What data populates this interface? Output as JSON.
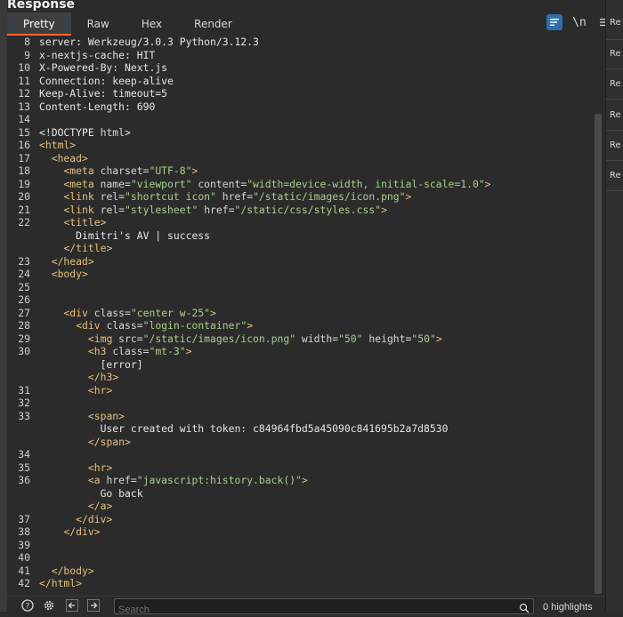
{
  "panel": {
    "title": "Response"
  },
  "tabs": [
    {
      "label": "Pretty",
      "active": true
    },
    {
      "label": "Raw"
    },
    {
      "label": "Hex"
    },
    {
      "label": "Render"
    }
  ],
  "toolbar": {
    "wrap_icon": "wrap-lines-icon",
    "newline_label": "\\n",
    "menu_icon": "hamburger-menu-icon"
  },
  "lines": [
    {
      "n": "8",
      "text": "server: Werkzeug/3.0.3 Python/3.12.3"
    },
    {
      "n": "9",
      "text": "x-nextjs-cache: HIT"
    },
    {
      "n": "10",
      "text": "X-Powered-By: Next.js"
    },
    {
      "n": "11",
      "text": "Connection: keep-alive"
    },
    {
      "n": "12",
      "text": "Keep-Alive: timeout=5"
    },
    {
      "n": "13",
      "text": "Content-Length: 690"
    },
    {
      "n": "14",
      "text": ""
    },
    {
      "n": "15",
      "text": "<!DOCTYPE html>"
    },
    {
      "n": "16",
      "text": "<html>"
    },
    {
      "n": "17",
      "text": "  <head>"
    },
    {
      "n": "18",
      "text": "    <meta charset=\"UTF-8\">"
    },
    {
      "n": "19",
      "text": "    <meta name=\"viewport\" content=\"width=device-width, initial-scale=1.0\">"
    },
    {
      "n": "20",
      "text": "    <link rel=\"shortcut icon\" href=\"/static/images/icon.png\">"
    },
    {
      "n": "21",
      "text": "    <link rel=\"stylesheet\" href=\"/static/css/styles.css\">"
    },
    {
      "n": "22",
      "text": "    <title>"
    },
    {
      "n": "",
      "text": "      Dimitri's AV | success"
    },
    {
      "n": "",
      "text": "    </title>"
    },
    {
      "n": "23",
      "text": "  </head>"
    },
    {
      "n": "24",
      "text": "  <body>"
    },
    {
      "n": "25",
      "text": ""
    },
    {
      "n": "26",
      "text": ""
    },
    {
      "n": "27",
      "text": "    <div class=\"center w-25\">"
    },
    {
      "n": "28",
      "text": "      <div class=\"login-container\">"
    },
    {
      "n": "29",
      "text": "        <img src=\"/static/images/icon.png\" width=\"50\" height=\"50\">"
    },
    {
      "n": "30",
      "text": "        <h3 class=\"mt-3\">"
    },
    {
      "n": "",
      "text": "          [error]"
    },
    {
      "n": "",
      "text": "        </h3>"
    },
    {
      "n": "31",
      "text": "        <hr>"
    },
    {
      "n": "32",
      "text": ""
    },
    {
      "n": "33",
      "text": "        <span>"
    },
    {
      "n": "",
      "text": "          User created with token: c84964fbd5a45090c841695b2a7d8530"
    },
    {
      "n": "",
      "text": "        </span>"
    },
    {
      "n": "34",
      "text": ""
    },
    {
      "n": "35",
      "text": "        <hr>"
    },
    {
      "n": "36",
      "text": "        <a href=\"javascript:history.back()\">"
    },
    {
      "n": "",
      "text": "          Go back"
    },
    {
      "n": "",
      "text": "        </a>"
    },
    {
      "n": "37",
      "text": "      </div>"
    },
    {
      "n": "38",
      "text": "    </div>"
    },
    {
      "n": "39",
      "text": ""
    },
    {
      "n": "40",
      "text": ""
    },
    {
      "n": "41",
      "text": "  </body>"
    },
    {
      "n": "42",
      "text": "</html>"
    }
  ],
  "side_panel": {
    "items": [
      "Re",
      "Re",
      "Re",
      "Re",
      "Re",
      "Re"
    ]
  },
  "bottom_bar": {
    "help_icon": "help-icon",
    "settings_icon": "gear-icon",
    "back_icon": "arrow-left-icon",
    "forward_icon": "arrow-right-icon",
    "search_placeholder": "Search",
    "search_icon": "search-icon",
    "highlights_label": "0 highlights"
  },
  "colors": {
    "tag": "#e5c07b",
    "value": "#a8d08d",
    "active_tab_underline": "#ff6633",
    "wrap_button": "#2f6fb0"
  }
}
